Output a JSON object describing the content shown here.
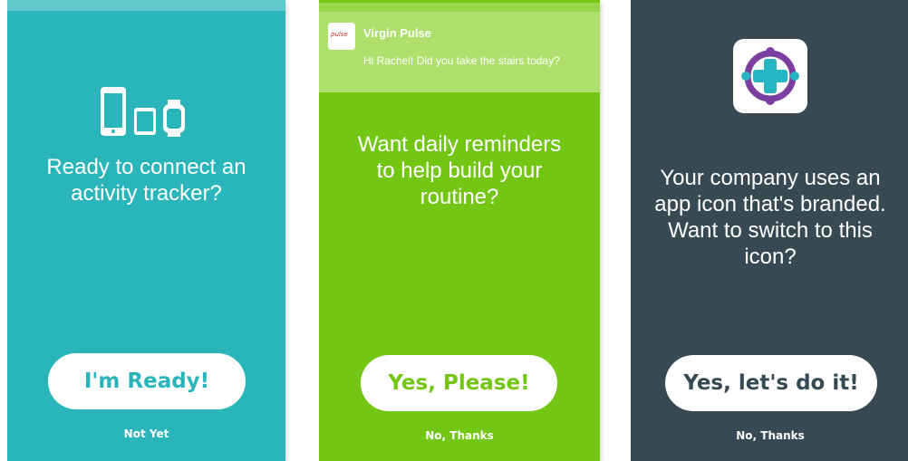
{
  "screen_tracker": {
    "headline_line1": "Ready to connect an",
    "headline_line2": "activity tracker?",
    "primary_label": "I'm Ready!",
    "secondary_label": "Not Yet",
    "accent": "#29b5b9"
  },
  "screen_reminders": {
    "notification": {
      "app_name": "Virgin Pulse",
      "message": "Hi Rachel! Did you take the stairs today?"
    },
    "headline_line1": "Want daily reminders",
    "headline_line2": "to help build your",
    "headline_line3": "routine?",
    "primary_label": "Yes, Please!",
    "secondary_label": "No, Thanks",
    "accent": "#74c614"
  },
  "screen_branding": {
    "headline_line1": "Your company uses an",
    "headline_line2": "app icon that's branded.",
    "headline_line3": "Want to switch to this",
    "headline_line4": "icon?",
    "primary_label": "Yes, let's do it!",
    "secondary_label": "No, Thanks",
    "accent": "#374952"
  }
}
